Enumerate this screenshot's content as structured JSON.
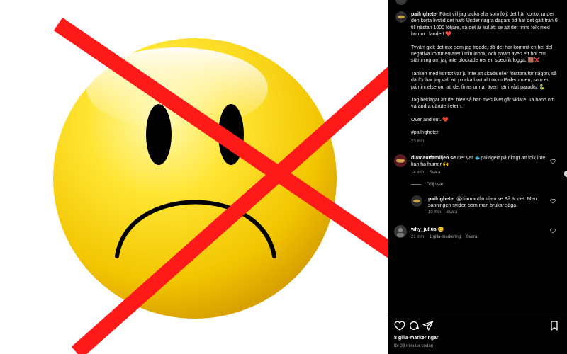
{
  "post": {
    "username": "pailrigheter",
    "paragraphs": [
      "Först vill jag tacka alla som följt det här kontot under den korta livstid det haft! Under några dagars tid har det gått från 0 till nästan 1000 följare, så det är kul att se att det finns folk med humor i landet! ❤️",
      "Tyvärr gick det inte som jag trodde, då det har kommit en hel del negativa kommentarer i min inbox, och tyvärr även ett hot om stämning om jag inte plockade ner en specifik logga. 🟫❌",
      "Tanken med kontot var ju inte att skada eller förstöra för någon, så därför har jag valt att plocka bort allt utom Pailerormen, som en påminnelse om att det finns ormar även här i vårt paradis. 🐍",
      "Jag beklagar att det blev så här, men livet går vidare. Ta hand om varandra därute i etern.",
      "Over and out. ❤️",
      "#pailrigheter"
    ],
    "time": "23 min"
  },
  "comments": [
    {
      "username": "diamantfamiljen.se",
      "text": "Det var 🐟pailrigert på riktigt att folk inte kan ha humor 🙌",
      "time": "14 min",
      "reply_label": "Svara",
      "hide_replies": "Dölj svar"
    },
    {
      "username": "pailrigheter",
      "text": "@diamantfamiljen.se Så är det. Men sanningen svider, som man brukar säga.",
      "time": "10 min",
      "reply_label": "Svara"
    },
    {
      "username": "why_julius",
      "text": "😊",
      "time": "21 min",
      "likes": "1 gilla-markering",
      "reply_label": "Svara"
    }
  ],
  "footer": {
    "likes": "8 gilla-markeringar",
    "ago": "för 23 minuter sedan"
  },
  "colors": {
    "panel_bg": "#000000",
    "cross_red": "#ff1a1a",
    "face_yellow": "#f5cc00"
  },
  "icons": [
    "heart-icon",
    "comment-icon",
    "share-icon",
    "save-icon"
  ]
}
